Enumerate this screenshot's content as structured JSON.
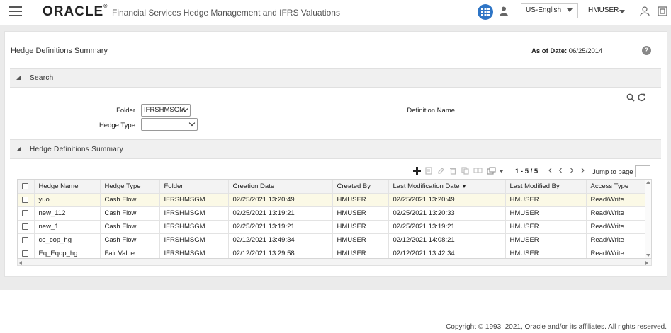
{
  "header": {
    "logo": "ORACLE",
    "logo_mark": "®",
    "app_title": "Financial Services Hedge Management and IFRS Valuations",
    "language": "US-English",
    "user": "HMUSER"
  },
  "page": {
    "title": "Hedge Definitions Summary",
    "as_of_label": "As of Date:",
    "as_of_value": "06/25/2014",
    "help": "?"
  },
  "search": {
    "section_title": "Search",
    "folder_label": "Folder",
    "folder_value": "IFRSHMSGM",
    "hedge_type_label": "Hedge Type",
    "hedge_type_value": "",
    "definition_name_label": "Definition Name",
    "definition_name_value": ""
  },
  "summary": {
    "section_title": "Hedge Definitions Summary",
    "pager": "1 - 5 / 5",
    "jump_label": "Jump to page",
    "jump_value": "",
    "columns": [
      "Hedge Name",
      "Hedge Type",
      "Folder",
      "Creation Date",
      "Created By",
      "Last Modification Date",
      "Last Modified By",
      "Access Type"
    ],
    "sort_indicator": "▼",
    "rows": [
      {
        "name": "yuo",
        "type": "Cash Flow",
        "folder": "IFRSHMSGM",
        "created": "02/25/2021 13:20:49",
        "created_by": "HMUSER",
        "modified": "02/25/2021 13:20:49",
        "modified_by": "HMUSER",
        "access": "Read/Write"
      },
      {
        "name": "new_112",
        "type": "Cash Flow",
        "folder": "IFRSHMSGM",
        "created": "02/25/2021 13:19:21",
        "created_by": "HMUSER",
        "modified": "02/25/2021 13:20:33",
        "modified_by": "HMUSER",
        "access": "Read/Write"
      },
      {
        "name": "new_1",
        "type": "Cash Flow",
        "folder": "IFRSHMSGM",
        "created": "02/25/2021 13:19:21",
        "created_by": "HMUSER",
        "modified": "02/25/2021 13:19:21",
        "modified_by": "HMUSER",
        "access": "Read/Write"
      },
      {
        "name": "co_cop_hg",
        "type": "Cash Flow",
        "folder": "IFRSHMSGM",
        "created": "02/12/2021 13:49:34",
        "created_by": "HMUSER",
        "modified": "02/12/2021 14:08:21",
        "modified_by": "HMUSER",
        "access": "Read/Write"
      },
      {
        "name": "Eq_Eqop_hg",
        "type": "Fair Value",
        "folder": "IFRSHMSGM",
        "created": "02/12/2021 13:29:58",
        "created_by": "HMUSER",
        "modified": "02/12/2021 13:42:34",
        "modified_by": "HMUSER",
        "access": "Read/Write"
      }
    ]
  },
  "footer": {
    "copyright": "Copyright © 1993, 2021, Oracle and/or its affiliates. All rights reserved."
  },
  "colors": {
    "accent": "#2e75c6",
    "selected_row": "#fbf9e6",
    "section_bar": "#f0f0f0"
  }
}
